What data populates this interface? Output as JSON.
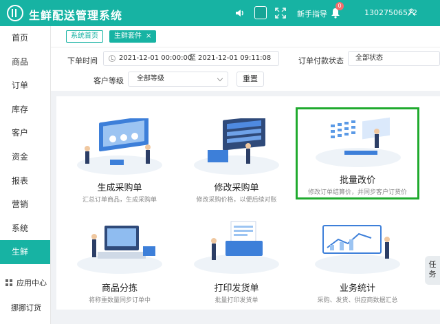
{
  "header": {
    "app_title": "生鲜配送管理系统",
    "guide_label": "新手指导",
    "notification_count": "0",
    "user_phone": "13027506572"
  },
  "sidebar": {
    "items": [
      {
        "label": "首页"
      },
      {
        "label": "商品"
      },
      {
        "label": "订单"
      },
      {
        "label": "库存"
      },
      {
        "label": "客户"
      },
      {
        "label": "资金"
      },
      {
        "label": "报表"
      },
      {
        "label": "营销"
      },
      {
        "label": "系统"
      },
      {
        "label": "生鲜",
        "active": true
      }
    ],
    "apps_label": "应用中心",
    "footer_label": "挪挪订货"
  },
  "tags": {
    "home": "系统首页",
    "current": "生鲜套件"
  },
  "filters": {
    "order_time_label": "下单时间",
    "start_time": "2021-12-01 00:00:00",
    "range_sep": "至",
    "end_time": "2021-12-01 09:11:08",
    "pay_status_label": "订单付款状态",
    "pay_status_value": "全部状态",
    "customer_level_label": "客户等级",
    "customer_level_value": "全部等级",
    "reset_label": "重置"
  },
  "cards": [
    {
      "title": "生成采购单",
      "desc": "汇总订单商品，生成采购单"
    },
    {
      "title": "修改采购单",
      "desc": "修改采购价格，以便后续对账"
    },
    {
      "title": "批量改价",
      "desc": "修改订单结算价，并同步客户订货价"
    },
    {
      "title": "商品分拣",
      "desc": "将称重数量同步订单中"
    },
    {
      "title": "打印发货单",
      "desc": "批量打印发货单"
    },
    {
      "title": "业务统计",
      "desc": "采购、发货、供应商数据汇总"
    }
  ],
  "task_tab": {
    "line1": "任",
    "line2": "务"
  },
  "colors": {
    "brand": "#17b3a3",
    "highlight": "#1faa2e"
  }
}
